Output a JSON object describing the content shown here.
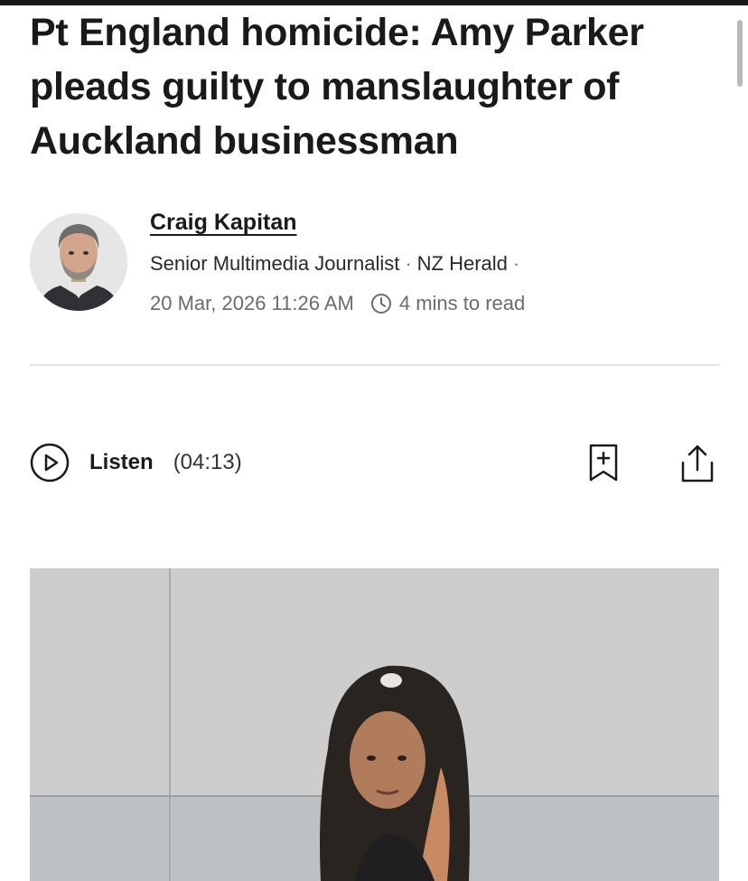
{
  "article": {
    "headline": "Pt England homicide: Amy Parker pleads guilty to manslaughter of Auckland businessman"
  },
  "author": {
    "name": "Craig Kapitan",
    "role": "Senior Multimedia Journalist",
    "outlet": "NZ Herald",
    "date": "20 Mar, 2026 11:26 AM",
    "read_time": "4 mins to read"
  },
  "audio": {
    "listen_label": "Listen",
    "duration": "(04:13)"
  },
  "icons": {
    "play": "play-circle-icon",
    "clock": "clock-icon",
    "bookmark": "bookmark-add-icon",
    "share": "share-icon"
  },
  "colors": {
    "text": "#1a1a1a",
    "muted": "#6b6b6b",
    "divider": "#e2e2e2"
  }
}
